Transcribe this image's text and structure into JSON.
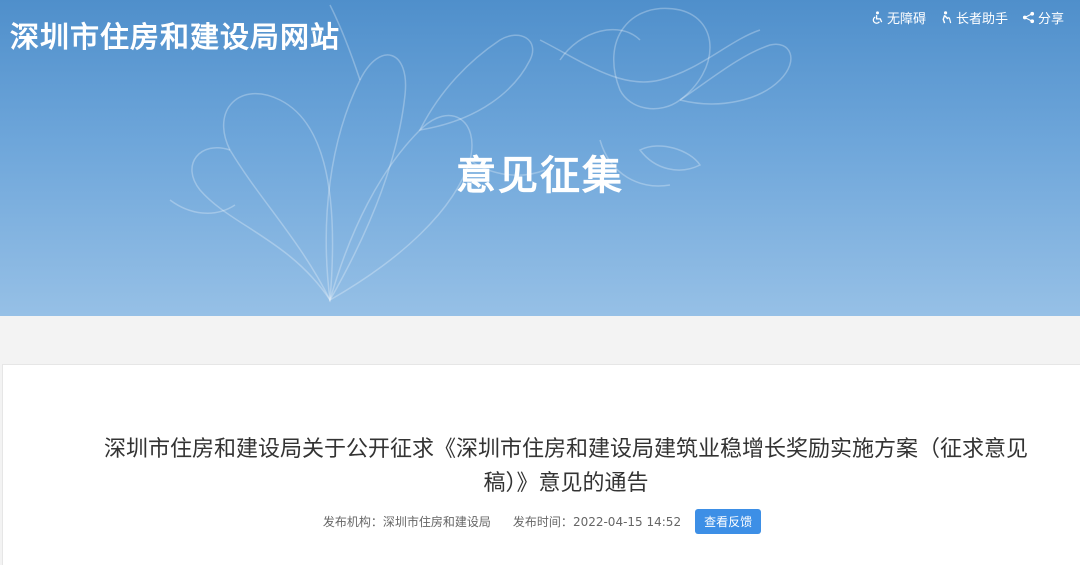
{
  "header": {
    "site_title": "深圳市住房和建设局网站",
    "tools": {
      "accessibility": "无障碍",
      "elder_helper": "长者助手",
      "share": "分享"
    }
  },
  "banner": {
    "title": "意见征集"
  },
  "article": {
    "title": "深圳市住房和建设局关于公开征求《深圳市住房和建设局建筑业稳增长奖励实施方案（征求意见稿）》意见的通告",
    "publisher_label": "发布机构：",
    "publisher": "深圳市住房和建设局",
    "time_label": "发布时间：",
    "publish_time": "2022-04-15 14:52",
    "feedback_button": "查看反馈"
  },
  "colors": {
    "banner_top": "#4f8fcb",
    "banner_bottom": "#96c0e6",
    "button": "#3d8fe6"
  }
}
